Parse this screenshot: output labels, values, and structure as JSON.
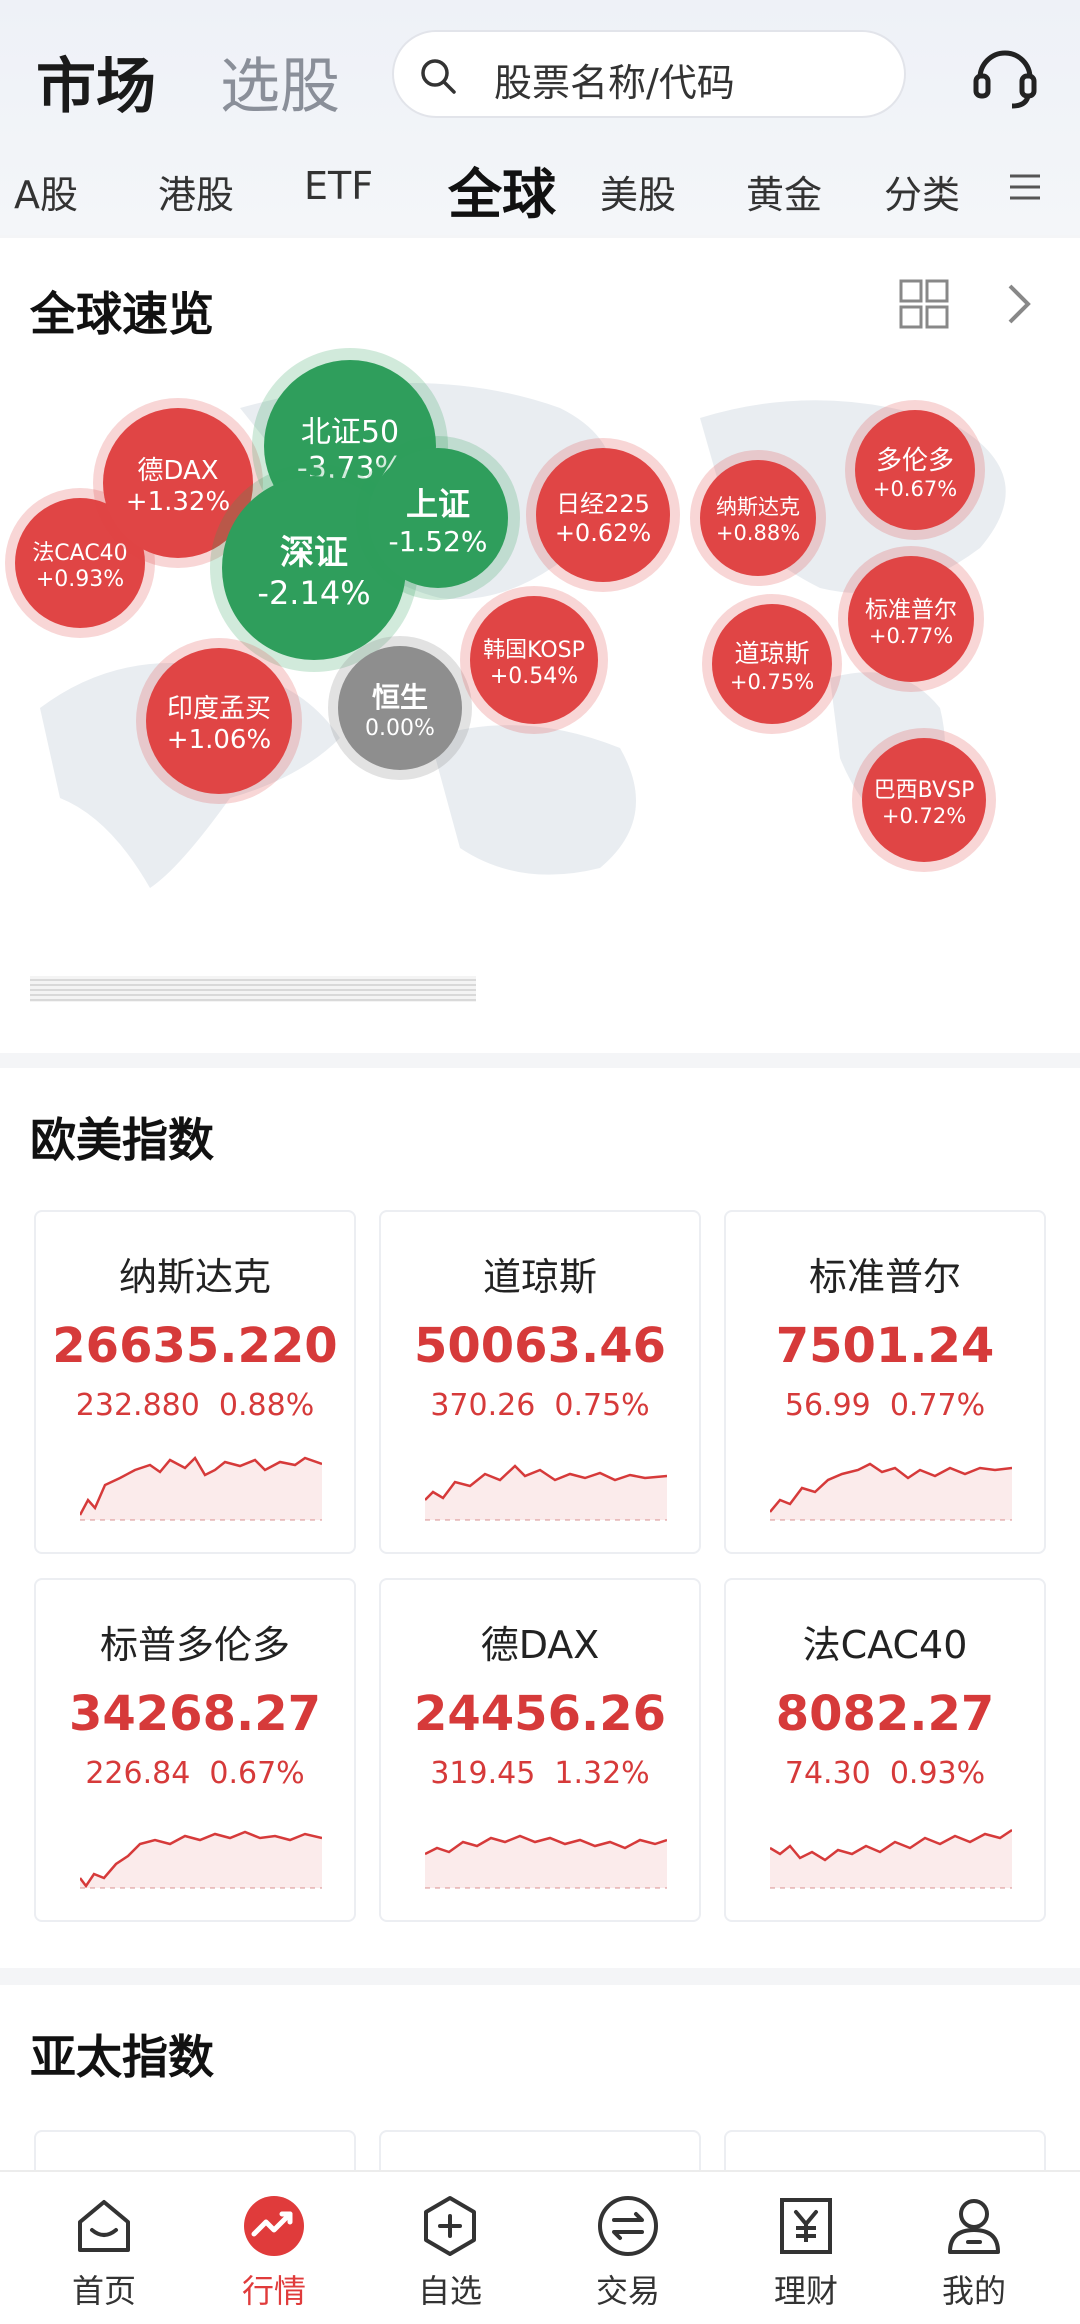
{
  "header": {
    "title_market": "市场",
    "title_pick": "选股",
    "search_placeholder": "股票名称/代码",
    "support_icon": "headset-icon"
  },
  "tabs": [
    {
      "label": "A股",
      "active": false
    },
    {
      "label": "港股",
      "active": false
    },
    {
      "label": "ETF",
      "active": false
    },
    {
      "label": "全球",
      "active": true
    },
    {
      "label": "美股",
      "active": false
    },
    {
      "label": "黄金",
      "active": false
    },
    {
      "label": "分类",
      "active": false
    }
  ],
  "overview": {
    "title": "全球速览",
    "bubbles": [
      {
        "name": "法CAC40",
        "pct": "+0.93%",
        "trend": "up"
      },
      {
        "name": "德DAX",
        "pct": "+1.32%",
        "trend": "up"
      },
      {
        "name": "北证50",
        "pct": "-3.73%",
        "trend": "down"
      },
      {
        "name": "深证",
        "pct": "-2.14%",
        "trend": "down"
      },
      {
        "name": "上证",
        "pct": "-1.52%",
        "trend": "down"
      },
      {
        "name": "印度孟买",
        "pct": "+1.06%",
        "trend": "up"
      },
      {
        "name": "恒生",
        "pct": "0.00%",
        "trend": "flat"
      },
      {
        "name": "韩国KOSP",
        "pct": "+0.54%",
        "trend": "up"
      },
      {
        "name": "日经225",
        "pct": "+0.62%",
        "trend": "up"
      },
      {
        "name": "纳斯达克",
        "pct": "+0.88%",
        "trend": "up"
      },
      {
        "name": "道琼斯",
        "pct": "+0.75%",
        "trend": "up"
      },
      {
        "name": "多伦多",
        "pct": "+0.67%",
        "trend": "up"
      },
      {
        "name": "标准普尔",
        "pct": "+0.77%",
        "trend": "up"
      },
      {
        "name": "巴西BVSP",
        "pct": "+0.72%",
        "trend": "up"
      }
    ]
  },
  "us_indices": {
    "title": "欧美指数",
    "cards": [
      {
        "name": "纳斯达克",
        "value": "26635.220",
        "change": "232.880",
        "pct": "0.88%"
      },
      {
        "name": "道琼斯",
        "value": "50063.46",
        "change": "370.26",
        "pct": "0.75%"
      },
      {
        "name": "标准普尔",
        "value": "7501.24",
        "change": "56.99",
        "pct": "0.77%"
      },
      {
        "name": "标普多伦多",
        "value": "34268.27",
        "change": "226.84",
        "pct": "0.67%"
      },
      {
        "name": "德DAX",
        "value": "24456.26",
        "change": "319.45",
        "pct": "1.32%"
      },
      {
        "name": "法CAC40",
        "value": "8082.27",
        "change": "74.30",
        "pct": "0.93%"
      }
    ]
  },
  "ap_indices": {
    "title": "亚太指数"
  },
  "colors": {
    "up": "#e04545",
    "down": "#2f9e5c",
    "flat": "#8e8e8e",
    "accent": "#e03b3b"
  },
  "bottom_nav": [
    {
      "label": "首页",
      "icon": "home-icon",
      "active": false
    },
    {
      "label": "行情",
      "icon": "market-trend-icon",
      "active": true
    },
    {
      "label": "自选",
      "icon": "watchlist-add-icon",
      "active": false
    },
    {
      "label": "交易",
      "icon": "trade-exchange-icon",
      "active": false
    },
    {
      "label": "理财",
      "icon": "wealth-yuan-icon",
      "active": false
    },
    {
      "label": "我的",
      "icon": "profile-icon",
      "active": false
    }
  ]
}
